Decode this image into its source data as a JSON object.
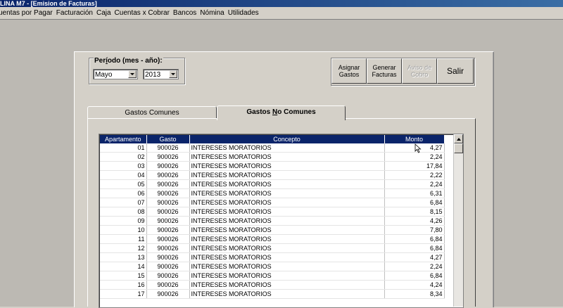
{
  "window": {
    "title": "LINA M7 - [Emision de Facturas]"
  },
  "menu": [
    "uentas por Pagar",
    "Facturación",
    "Caja",
    "Cuentas x Cobrar",
    "Bancos",
    "Nómina",
    "Utilidades"
  ],
  "period": {
    "label_prefix": "Per",
    "label_underlined": "í",
    "label_suffix": "odo (mes - año):",
    "month": "Mayo",
    "year": "2013"
  },
  "buttons": {
    "asignar": "Asignar\nGastos",
    "generar": "Generar\nFacturas",
    "aviso": "Aviso de\nCobro",
    "salir": "Salir"
  },
  "tabs": {
    "comunes": "Gastos Comunes",
    "no_comunes_prefix": "Gastos ",
    "no_comunes_underlined": "N",
    "no_comunes_suffix": "o Comunes"
  },
  "grid": {
    "columns": [
      "Apartamento",
      "Gasto",
      "Concepto",
      "Monto"
    ],
    "rows": [
      [
        "01",
        "900026",
        "INTERESES MORATORIOS",
        "4,27"
      ],
      [
        "02",
        "900026",
        "INTERESES MORATORIOS",
        "2,24"
      ],
      [
        "03",
        "900026",
        "INTERESES MORATORIOS",
        "17,84"
      ],
      [
        "04",
        "900026",
        "INTERESES MORATORIOS",
        "2,22"
      ],
      [
        "05",
        "900026",
        "INTERESES MORATORIOS",
        "2,24"
      ],
      [
        "06",
        "900026",
        "INTERESES MORATORIOS",
        "6,31"
      ],
      [
        "07",
        "900026",
        "INTERESES MORATORIOS",
        "6,84"
      ],
      [
        "08",
        "900026",
        "INTERESES MORATORIOS",
        "8,15"
      ],
      [
        "09",
        "900026",
        "INTERESES MORATORIOS",
        "4,26"
      ],
      [
        "10",
        "900026",
        "INTERESES MORATORIOS",
        "7,80"
      ],
      [
        "11",
        "900026",
        "INTERESES MORATORIOS",
        "6,84"
      ],
      [
        "12",
        "900026",
        "INTERESES MORATORIOS",
        "6,84"
      ],
      [
        "13",
        "900026",
        "INTERESES MORATORIOS",
        "4,27"
      ],
      [
        "14",
        "900026",
        "INTERESES MORATORIOS",
        "2,24"
      ],
      [
        "15",
        "900026",
        "INTERESES MORATORIOS",
        "6,84"
      ],
      [
        "16",
        "900026",
        "INTERESES MORATORIOS",
        "4,24"
      ],
      [
        "17",
        "900026",
        "INTERESES MORATORIOS",
        "8,34"
      ]
    ]
  },
  "colors": {
    "titlebar": "#0a246a",
    "grid_header": "#0a246a",
    "face": "#d4d0c8"
  }
}
